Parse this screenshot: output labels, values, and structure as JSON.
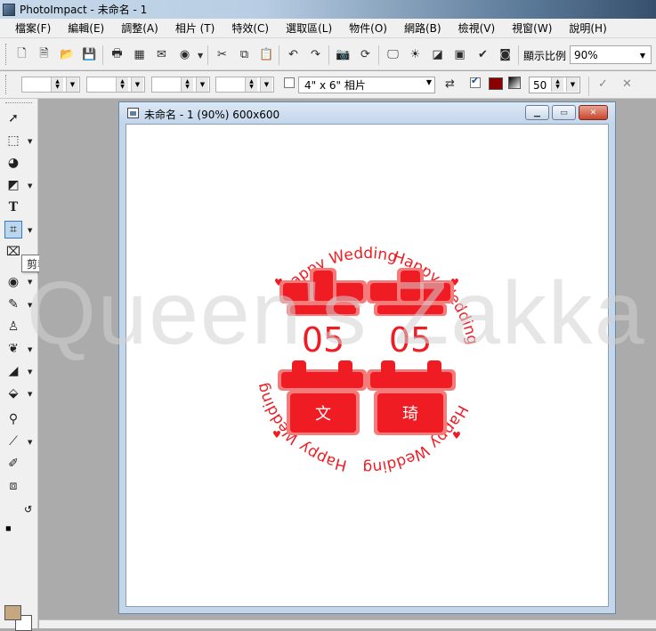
{
  "app": {
    "title": "PhotoImpact - 未命名 - 1"
  },
  "menu": {
    "items": [
      "檔案(F)",
      "編輯(E)",
      "調整(A)",
      "相片 (T)",
      "特效(C)",
      "選取區(L)",
      "物件(O)",
      "網路(B)",
      "檢視(V)",
      "視窗(W)",
      "說明(H)"
    ]
  },
  "toolbar": {
    "zoom_label": "顯示比例",
    "zoom_value": "90%"
  },
  "property_bar": {
    "paper_size": "4\" x 6\" 相片",
    "opacity_value": "50",
    "color_swatch": "#8a0000"
  },
  "toolbox": {
    "tooltip": "剪裁工具 [R]",
    "foreground_color": "#c5a882",
    "background_color": "#ffffff"
  },
  "document": {
    "title": "未命名 - 1 (90%) 600x600"
  },
  "artwork": {
    "ring_text_top": "Happy Wedding",
    "ring_text_right": "Happy Wedding",
    "ring_text_bottom": "Happy Wedding",
    "ring_text_left": "Happy Wedding",
    "date_left": "05",
    "date_right": "05",
    "name_left": "文",
    "name_right": "琦",
    "accent": "#ef1c24"
  },
  "watermark": {
    "text": "Queen's Zakka"
  }
}
